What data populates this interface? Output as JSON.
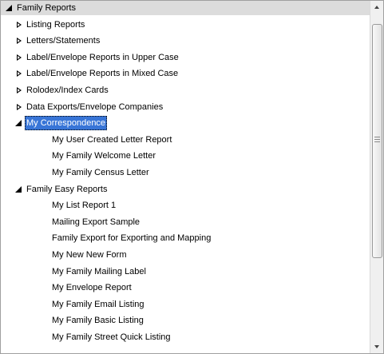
{
  "tree": {
    "nodes": [
      {
        "label": "Family Reports",
        "level": 0,
        "state": "expanded",
        "root": true
      },
      {
        "label": "Listing Reports",
        "level": 1,
        "state": "collapsed"
      },
      {
        "label": "Letters/Statements",
        "level": 1,
        "state": "collapsed"
      },
      {
        "label": "Label/Envelope Reports in Upper Case",
        "level": 1,
        "state": "collapsed"
      },
      {
        "label": "Label/Envelope Reports in Mixed Case",
        "level": 1,
        "state": "collapsed"
      },
      {
        "label": "Rolodex/Index Cards",
        "level": 1,
        "state": "collapsed"
      },
      {
        "label": "Data Exports/Envelope Companies",
        "level": 1,
        "state": "collapsed"
      },
      {
        "label": "My Correspondence",
        "level": 1,
        "state": "expanded",
        "selected": true
      },
      {
        "label": "My User Created Letter Report",
        "level": 2,
        "state": "leaf"
      },
      {
        "label": "My Family Welcome Letter",
        "level": 2,
        "state": "leaf"
      },
      {
        "label": "My Family Census Letter",
        "level": 2,
        "state": "leaf"
      },
      {
        "label": "Family Easy Reports",
        "level": 1,
        "state": "expanded"
      },
      {
        "label": "My List Report 1",
        "level": 2,
        "state": "leaf"
      },
      {
        "label": "Mailing Export Sample",
        "level": 2,
        "state": "leaf"
      },
      {
        "label": "Family Export for Exporting and Mapping",
        "level": 2,
        "state": "leaf"
      },
      {
        "label": "My New New Form",
        "level": 2,
        "state": "leaf"
      },
      {
        "label": "My Family Mailing Label",
        "level": 2,
        "state": "leaf"
      },
      {
        "label": "My Envelope Report",
        "level": 2,
        "state": "leaf"
      },
      {
        "label": "My Family Email Listing",
        "level": 2,
        "state": "leaf"
      },
      {
        "label": "My Family Basic Listing",
        "level": 2,
        "state": "leaf"
      },
      {
        "label": "My Family Street Quick Listing",
        "level": 2,
        "state": "leaf"
      }
    ]
  },
  "colors": {
    "selection": "#3875d7",
    "root_band": "#dcdcdc"
  },
  "icons": {
    "expanded": "triangle-expanded-icon",
    "collapsed": "triangle-collapsed-icon",
    "scroll_up": "scroll-up-arrow-icon",
    "scroll_down": "scroll-down-arrow-icon"
  }
}
